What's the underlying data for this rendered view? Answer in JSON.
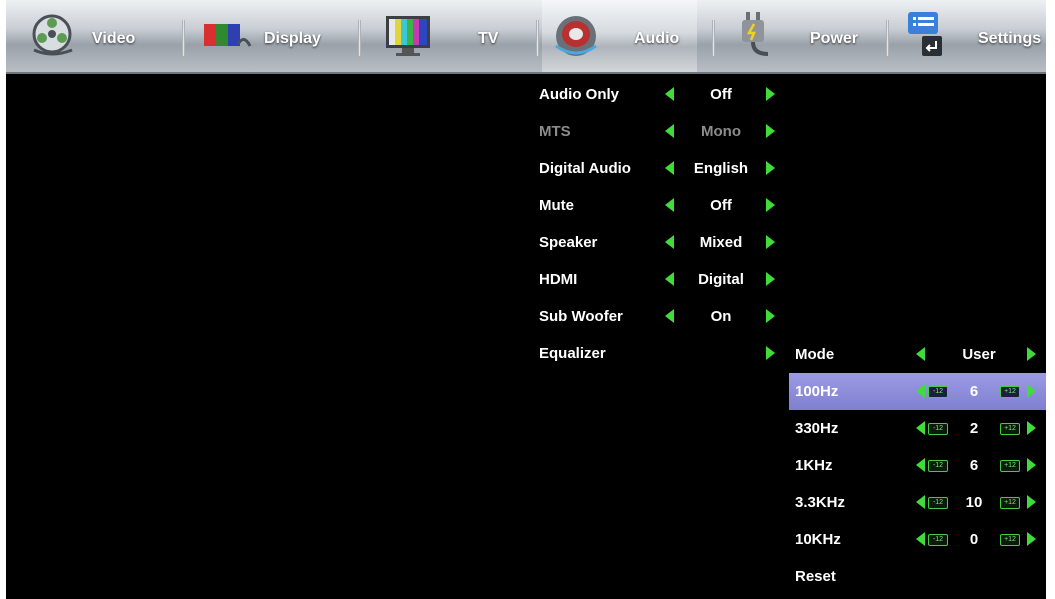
{
  "nav": {
    "tabs": [
      {
        "label": "Video",
        "icon": "film-reel-icon"
      },
      {
        "label": "Display",
        "icon": "display-icon"
      },
      {
        "label": "TV",
        "icon": "tv-test-pattern-icon"
      },
      {
        "label": "Audio",
        "icon": "speaker-icon"
      },
      {
        "label": "Power",
        "icon": "power-plug-icon"
      },
      {
        "label": "Settings",
        "icon": "settings-icon"
      }
    ],
    "active": "Audio"
  },
  "audio_menu": {
    "items": [
      {
        "label": "Audio Only",
        "value": "Off",
        "enabled": true
      },
      {
        "label": "MTS",
        "value": "Mono",
        "enabled": false
      },
      {
        "label": "Digital Audio",
        "value": "English",
        "enabled": true
      },
      {
        "label": "Mute",
        "value": "Off",
        "enabled": true
      },
      {
        "label": "Speaker",
        "value": "Mixed",
        "enabled": true
      },
      {
        "label": "HDMI",
        "value": "Digital",
        "enabled": true
      },
      {
        "label": "Sub Woofer",
        "value": "On",
        "enabled": true
      },
      {
        "label": "Equalizer",
        "value": "",
        "enabled": true
      }
    ]
  },
  "equalizer": {
    "mode_label": "Mode",
    "mode_value": "User",
    "min_chip": "-12",
    "max_chip": "+12",
    "bands": [
      {
        "label": "100Hz",
        "value": "6",
        "selected": true
      },
      {
        "label": "330Hz",
        "value": "2",
        "selected": false
      },
      {
        "label": "1KHz",
        "value": "6",
        "selected": false
      },
      {
        "label": "3.3KHz",
        "value": "10",
        "selected": false
      },
      {
        "label": "10KHz",
        "value": "0",
        "selected": false
      }
    ],
    "reset_label": "Reset"
  },
  "colors": {
    "arrow": "#3fdc3a",
    "highlight": "#8a8ad8",
    "disabled_text": "#8c8c8c"
  }
}
